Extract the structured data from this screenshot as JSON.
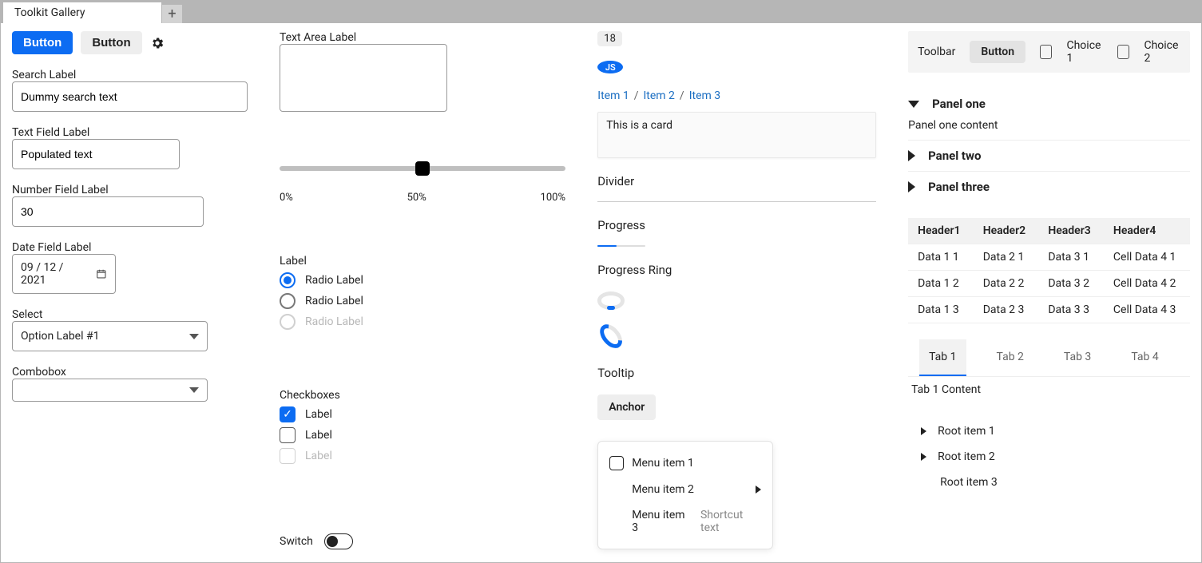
{
  "tabbar": {
    "title": "Toolkit Gallery"
  },
  "col1": {
    "buttons": {
      "primary": "Button",
      "neutral": "Button"
    },
    "search": {
      "label": "Search Label",
      "value": "Dummy search text"
    },
    "text": {
      "label": "Text Field Label",
      "value": "Populated text"
    },
    "number": {
      "label": "Number Field Label",
      "value": "30"
    },
    "date": {
      "label": "Date Field Label",
      "value": "09 / 12 / 2021"
    },
    "select": {
      "label": "Select",
      "value": "Option Label #1"
    },
    "combo": {
      "label": "Combobox"
    }
  },
  "col2": {
    "textarea": {
      "label": "Text Area Label"
    },
    "slider": {
      "ticks": [
        "0%",
        "50%",
        "100%"
      ]
    },
    "radios": {
      "group_label": "Label",
      "items": [
        {
          "label": "Radio Label",
          "state": "selected"
        },
        {
          "label": "Radio Label",
          "state": "unselected"
        },
        {
          "label": "Radio Label",
          "state": "disabled"
        }
      ]
    },
    "checks": {
      "group_label": "Checkboxes",
      "items": [
        {
          "label": "Label",
          "state": "checked"
        },
        {
          "label": "Label",
          "state": "un"
        },
        {
          "label": "Label",
          "state": "dis"
        }
      ]
    },
    "switch": {
      "label": "Switch"
    }
  },
  "col3": {
    "badge": "18",
    "avatar": "JS",
    "crumbs": [
      "Item 1",
      "Item 2",
      "Item 3"
    ],
    "card": "This is a card",
    "divider_label": "Divider",
    "progress_label": "Progress",
    "ring_label": "Progress Ring",
    "tooltip_label": "Tooltip",
    "anchor": "Anchor",
    "menu": {
      "item1": "Menu item 1",
      "item2": "Menu item 2",
      "item3": "Menu item 3",
      "shortcut": "Shortcut text"
    }
  },
  "col4": {
    "toolbar": {
      "label": "Toolbar",
      "button": "Button",
      "choice1": "Choice 1",
      "choice2": "Choice 2"
    },
    "accordion": {
      "p1_title": "Panel one",
      "p1_body": "Panel one content",
      "p2_title": "Panel two",
      "p3_title": "Panel three"
    },
    "table": {
      "headers": [
        "Header1",
        "Header2",
        "Header3",
        "Header4"
      ],
      "rows": [
        [
          "Data 1 1",
          "Data 2 1",
          "Data 3 1",
          "Cell Data 4 1"
        ],
        [
          "Data 1 2",
          "Data 2 2",
          "Data 3 2",
          "Cell Data 4 2"
        ],
        [
          "Data 1 3",
          "Data 2 3",
          "Data 3 3",
          "Cell Data 4 3"
        ]
      ]
    },
    "tabs": {
      "labels": [
        "Tab 1",
        "Tab 2",
        "Tab 3",
        "Tab 4"
      ],
      "content": "Tab 1 Content"
    },
    "tree": [
      "Root item 1",
      "Root item 2",
      "Root item 3"
    ]
  }
}
